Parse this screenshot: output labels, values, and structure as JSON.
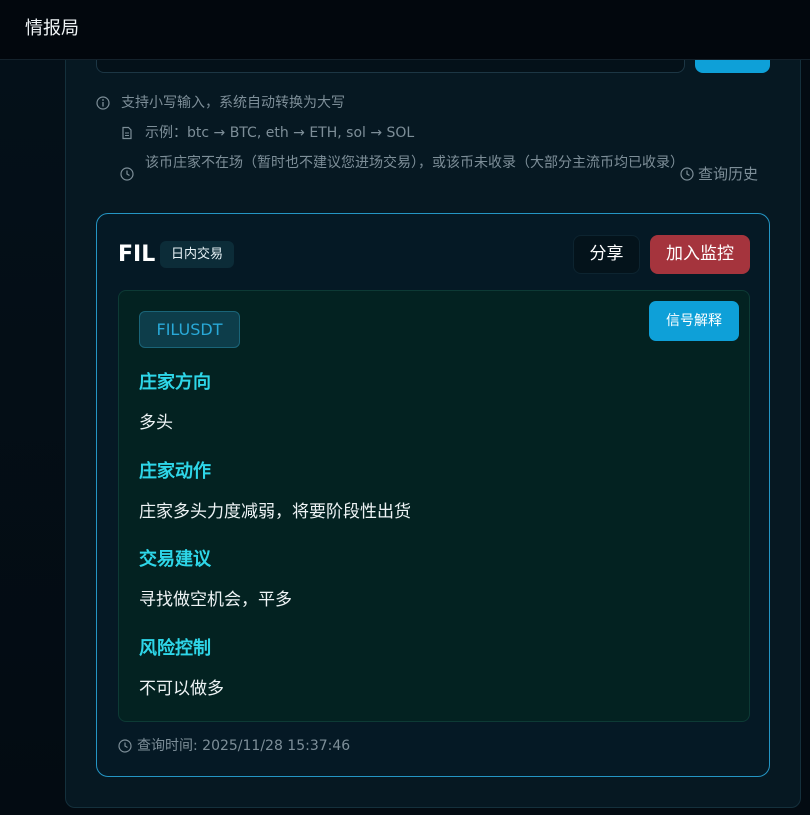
{
  "app": {
    "title": "情报局"
  },
  "hints": {
    "line1": "支持小写输入，系统自动转换为大写",
    "line2": "示例：btc → BTC, eth → ETH, sol → SOL",
    "line3": "该币庄家不在场（暂时也不建议您进场交易），或该币未收录（大部分主流币均已收录）"
  },
  "history_link": "查询历史",
  "result": {
    "symbol": "FIL",
    "tag": "日内交易",
    "share_label": "分享",
    "monitor_label": "加入监控",
    "pair": "FILUSDT",
    "explain_label": "信号解释",
    "sections": [
      {
        "heading": "庄家方向",
        "value": "多头"
      },
      {
        "heading": "庄家动作",
        "value": "庄家多头力度减弱，将要阶段性出货"
      },
      {
        "heading": "交易建议",
        "value": "寻找做空机会，平多"
      },
      {
        "heading": "风险控制",
        "value": "不可以做多"
      }
    ],
    "query_time": "查询时间: 2025/11/28 15:37:46"
  },
  "colors": {
    "accent": "#0ea0d8",
    "danger": "#a5343d",
    "heading": "#2ed6e8",
    "card_border": "#2495c4"
  }
}
